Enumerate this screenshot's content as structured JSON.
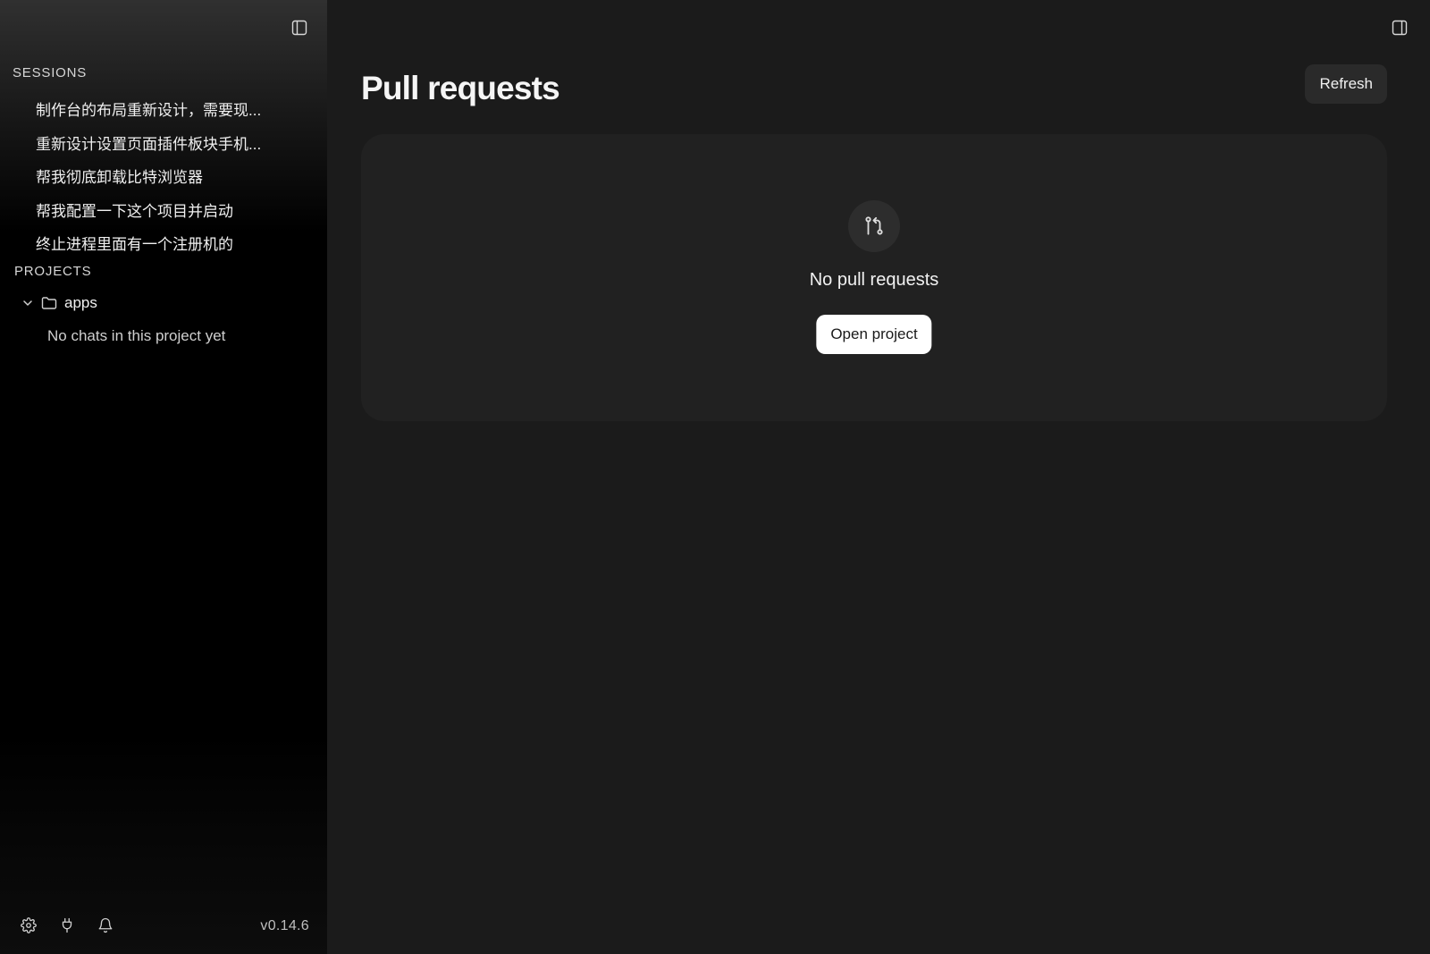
{
  "sidebar": {
    "sessions_label": "SESSIONS",
    "sessions": [
      "制作台的布局重新设计，需要现...",
      "重新设计设置页面插件板块手机...",
      "帮我彻底卸载比特浏览器",
      "帮我配置一下这个项目并启动",
      "终止进程里面有一个注册机的"
    ],
    "projects_label": "PROJECTS",
    "project": {
      "name": "apps",
      "empty_text": "No chats in this project yet"
    },
    "footer": {
      "icons": [
        "gear-icon",
        "plug-icon",
        "bell-icon"
      ],
      "version": "v0.14.6"
    }
  },
  "main": {
    "title": "Pull requests",
    "refresh_label": "Refresh",
    "empty_state": {
      "icon": "pull-request-icon",
      "title": "No pull requests",
      "button_label": "Open project"
    }
  },
  "colors": {
    "background": "#1b1b1b",
    "card": "#212121",
    "button_dark": "#2a2a2a",
    "button_light": "#ffffff",
    "text": "#f0f0f0"
  }
}
